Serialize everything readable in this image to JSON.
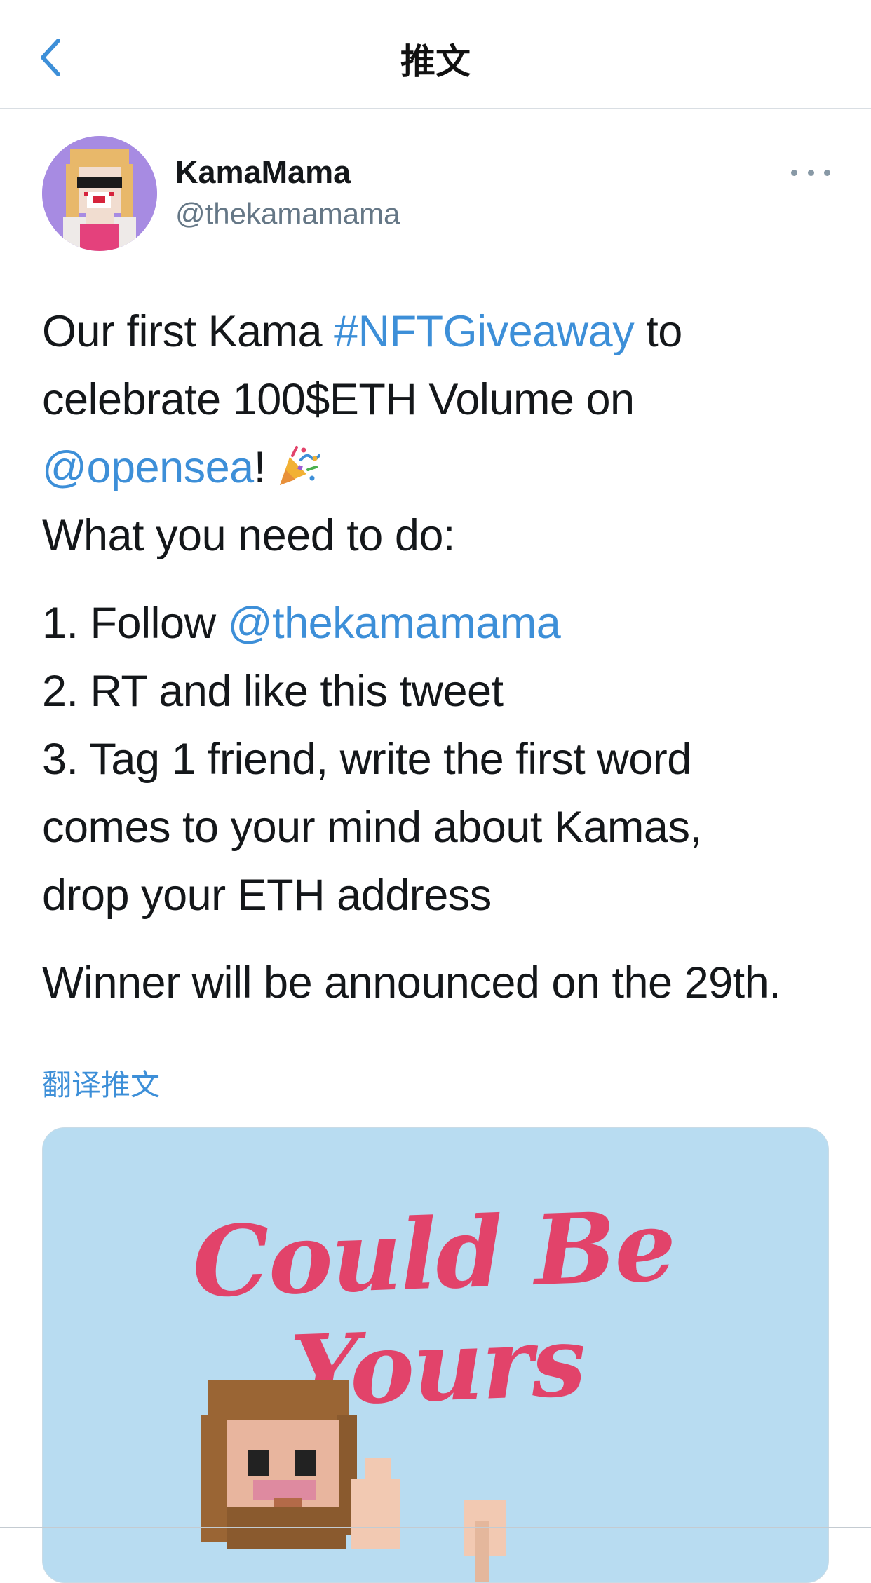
{
  "header": {
    "title": "推文",
    "back_icon": "chevron-left-icon",
    "accent_color": "#3d8fd8"
  },
  "author": {
    "name": "KamaMama",
    "handle": "@thekamamama",
    "avatar_bg": "#a78be2",
    "more_icon": "more-horizontal-icon"
  },
  "tweet": {
    "l1_pre": "Our first Kama ",
    "l1_link": "#NFTGiveaway",
    "l1_post": " to",
    "l2": "celebrate 100$ETH Volume on",
    "l3_link": "@opensea",
    "l3_post": "!",
    "l3_emoji": "party-popper-icon",
    "l4": "What you need to do:",
    "l5_pre": "1. Follow ",
    "l5_link": "@thekamamama",
    "l6": "2. RT and like this tweet",
    "l7": "3. Tag 1 friend, write the first word",
    "l8": "comes to your mind about Kamas,",
    "l9": "drop your ETH address",
    "l10": "Winner will be announced on the 29th."
  },
  "translate_label": "翻译推文",
  "media": {
    "headline": "Could Be Yours",
    "background": "#b8dcf1",
    "headline_color": "#e2436a"
  }
}
